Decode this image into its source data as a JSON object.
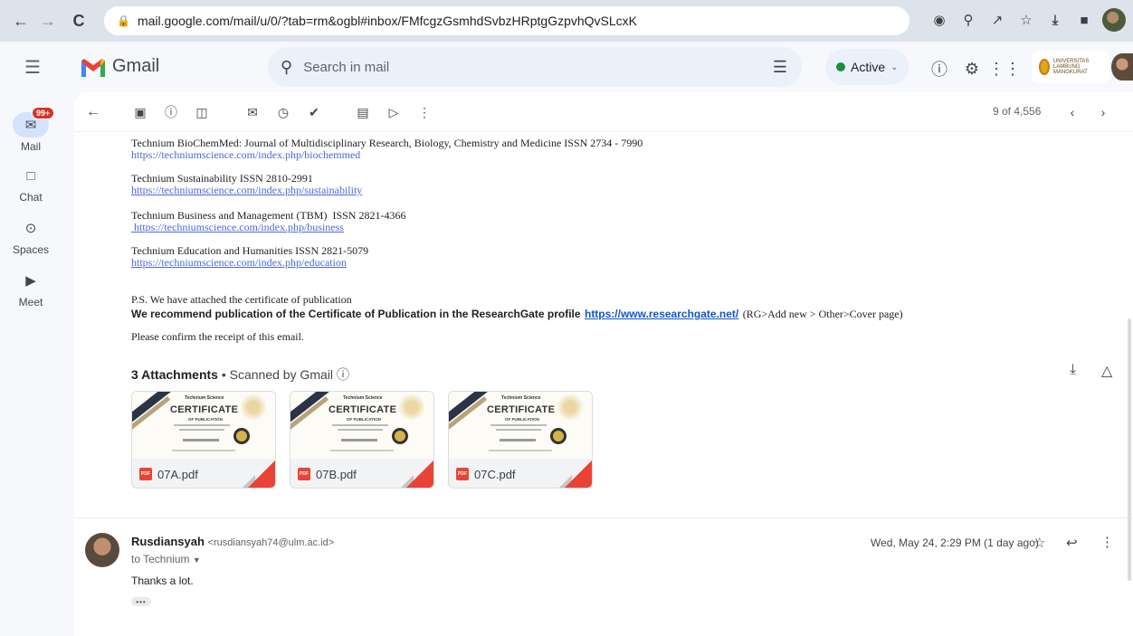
{
  "browser": {
    "url_host": "mail.google.com",
    "url_path": "/mail/u/0/?tab=rm&ogbl#inbox/FMfcgzGsmhdSvbzHRptgGzpvhQvSLcxK"
  },
  "header": {
    "app_name": "Gmail",
    "search_placeholder": "Search in mail",
    "status": "Active",
    "org_badge": "UNIVERSITAS LAMBUNG MANGKURAT"
  },
  "rail": {
    "badge": "99+",
    "items": [
      {
        "label": "Mail"
      },
      {
        "label": "Chat"
      },
      {
        "label": "Spaces"
      },
      {
        "label": "Meet"
      }
    ]
  },
  "toolbar": {
    "count": "9 of 4,556"
  },
  "email": {
    "journals": [
      {
        "name": "Technium BioChemMed: Journal of Multidisciplinary Research, Biology, Chemistry and Medicine ISSN 2734 - 7990",
        "url": "https://techniumscience.com/index.php/biochemmed"
      },
      {
        "name": "Technium Sustainability ISSN 2810-2991",
        "url": "https://techniumscience.com/index.php/sustainability"
      },
      {
        "name": "Technium Business and Management (TBM)  ISSN 2821-4366",
        "url": " https://techniumscience.com/index.php/business"
      },
      {
        "name": "Technium Education and Humanities ISSN 2821-5079",
        "url": "https://techniumscience.com/index.php/education"
      }
    ],
    "ps_line": "P.S. We have attached the certificate of publication",
    "recommend_bold": "We recommend publication of the Certificate of Publication in the ResearchGate profile",
    "recommend_link": "https://www.researchgate.net/",
    "recommend_tail": "(RG>Add new > Other>Cover page)",
    "confirm": "Please confirm the receipt of this email."
  },
  "attachments": {
    "title": "3 Attachments",
    "scanned": "Scanned by Gmail",
    "items": [
      {
        "name": "07A.pdf"
      },
      {
        "name": "07B.pdf"
      },
      {
        "name": "07C.pdf"
      }
    ],
    "cert_brand": "Technium Science",
    "cert_title": "CERTIFICATE",
    "cert_sub": "OF PUBLICATION"
  },
  "reply": {
    "sender": "Rusdiansyah",
    "email": "<rusdiansyah74@ulm.ac.id>",
    "to": "to Technium",
    "date": "Wed, May 24, 2:29 PM (1 day ago)",
    "body": "Thanks a lot."
  }
}
